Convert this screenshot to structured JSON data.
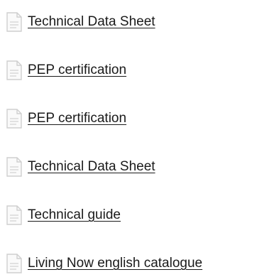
{
  "documents": [
    {
      "label": "Technical Data Sheet",
      "icon": "document-icon"
    },
    {
      "label": "PEP certification",
      "icon": "document-icon"
    },
    {
      "label": "PEP certification",
      "icon": "document-icon"
    },
    {
      "label": "Technical Data Sheet",
      "icon": "document-icon"
    },
    {
      "label": "Technical guide",
      "icon": "document-icon"
    },
    {
      "label": "Living Now english catalogue",
      "icon": "document-icon"
    }
  ]
}
